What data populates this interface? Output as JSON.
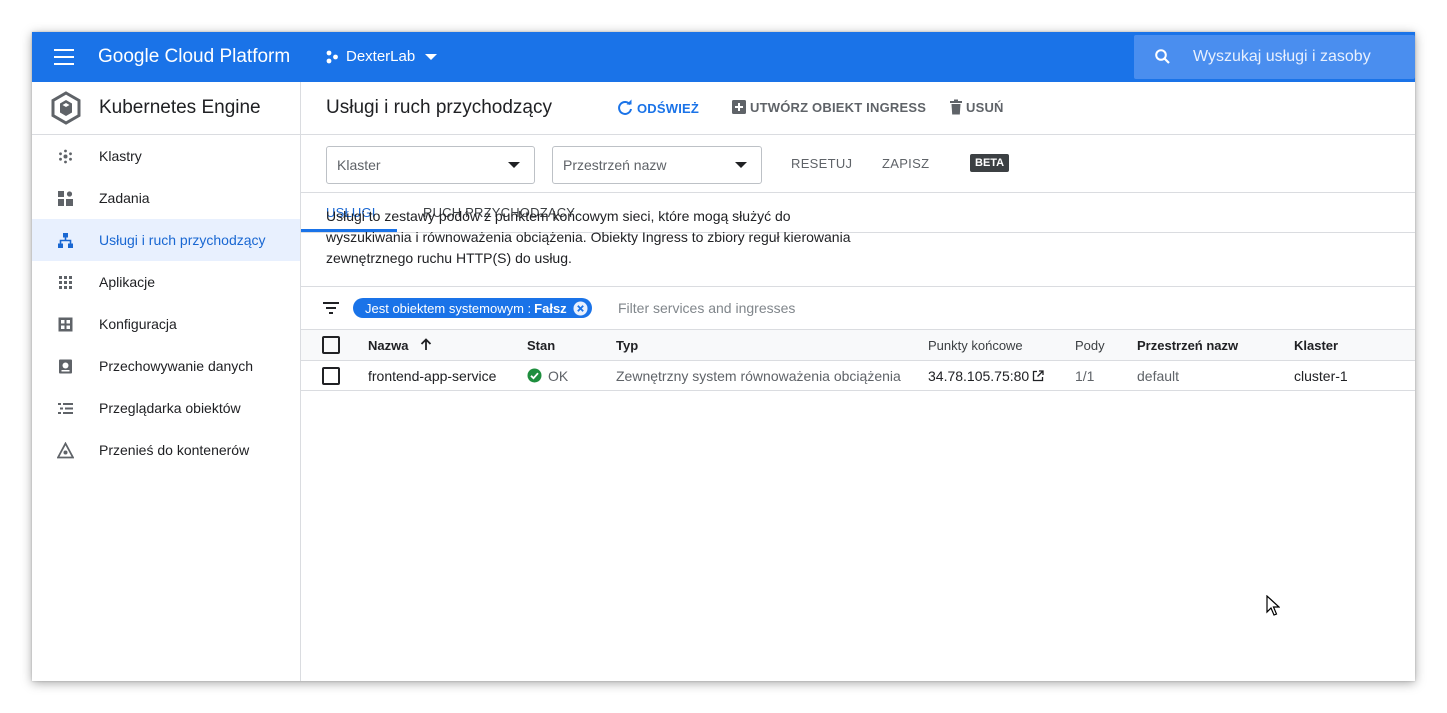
{
  "topbar": {
    "brand": "Google Cloud Platform",
    "project": "DexterLab",
    "search_placeholder": "Wyszukaj usługi i zasoby"
  },
  "sidebar": {
    "title": "Kubernetes Engine",
    "items": [
      {
        "label": "Klastry",
        "icon": "clusters-icon"
      },
      {
        "label": "Zadania",
        "icon": "workloads-icon"
      },
      {
        "label": "Usługi i ruch przychodzący",
        "icon": "services-icon",
        "active": true
      },
      {
        "label": "Aplikacje",
        "icon": "applications-icon"
      },
      {
        "label": "Konfiguracja",
        "icon": "configuration-icon"
      },
      {
        "label": "Przechowywanie danych",
        "icon": "storage-icon"
      },
      {
        "label": "Przeglądarka obiektów",
        "icon": "object-browser-icon"
      },
      {
        "label": "Przenieś do kontenerów",
        "icon": "migrate-icon"
      }
    ]
  },
  "header": {
    "title": "Usługi i ruch przychodzący",
    "refresh": "ODŚWIEŻ",
    "create_ingress": "UTWÓRZ OBIEKT INGRESS",
    "delete": "USUŃ"
  },
  "filters": {
    "cluster_placeholder": "Klaster",
    "namespace_placeholder": "Przestrzeń nazw",
    "reset": "RESETUJ",
    "save": "ZAPISZ",
    "beta": "BETA"
  },
  "tabs": [
    {
      "label": "USŁUGI",
      "active": true
    },
    {
      "label": "RUCH PRZYCHODZĄCY",
      "active": false
    }
  ],
  "description": "Usługi to zestawy podów z punktem końcowym sieci, które mogą służyć do wyszukiwania i równoważenia obciążenia. Obiekty Ingress to zbiory reguł kierowania zewnętrznego ruchu HTTP(S) do usług.",
  "chip": {
    "key": "Jest obiektem systemowym :",
    "value": "Fałsz"
  },
  "filter_placeholder": "Filter services and ingresses",
  "table": {
    "headers": {
      "name": "Nazwa",
      "status": "Stan",
      "type": "Typ",
      "endpoints": "Punkty końcowe",
      "pods": "Pody",
      "namespace": "Przestrzeń nazw",
      "cluster": "Klaster"
    },
    "rows": [
      {
        "name": "frontend-app-service",
        "status": "OK",
        "type": "Zewnętrzny system równoważenia obciążenia",
        "endpoints": "34.78.105.75:80",
        "pods": "1/1",
        "namespace": "default",
        "cluster": "cluster-1"
      }
    ]
  },
  "colors": {
    "accent": "#1a73e8",
    "ok_green": "#1e8e3e"
  }
}
